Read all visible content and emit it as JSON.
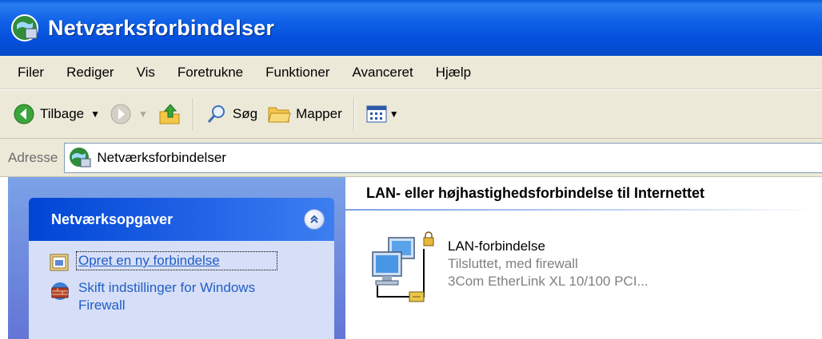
{
  "window": {
    "title": "Netværksforbindelser"
  },
  "menubar": {
    "items": [
      {
        "label": "Filer"
      },
      {
        "label": "Rediger"
      },
      {
        "label": "Vis"
      },
      {
        "label": "Foretrukne"
      },
      {
        "label": "Funktioner"
      },
      {
        "label": "Avanceret"
      },
      {
        "label": "Hjælp"
      }
    ]
  },
  "toolbar": {
    "back_label": "Tilbage",
    "search_label": "Søg",
    "folders_label": "Mapper",
    "icons": [
      "back-arrow-icon",
      "forward-arrow-icon",
      "up-folder-icon",
      "search-magnifier-icon",
      "folders-icon",
      "views-icon"
    ]
  },
  "address": {
    "label": "Adresse",
    "value": "Netværksforbindelser"
  },
  "taskpane": {
    "group_title": "Netværksopgaver",
    "links": [
      {
        "label": "Opret en ny forbindelse",
        "icon": "new-connection-icon"
      },
      {
        "label": "Skift indstillinger for Windows Firewall",
        "icon": "firewall-icon"
      }
    ]
  },
  "content": {
    "section_header": "LAN- eller højhastighedsforbindelse til Internettet",
    "connection": {
      "name": "LAN-forbindelse",
      "status": "Tilsluttet, med firewall",
      "device": "3Com EtherLink XL 10/100 PCI..."
    }
  },
  "colors": {
    "titlebar": "#0550dc",
    "chrome": "#ece9d8",
    "taskpane_header": "#0046d5",
    "task_link": "#215dc6"
  }
}
